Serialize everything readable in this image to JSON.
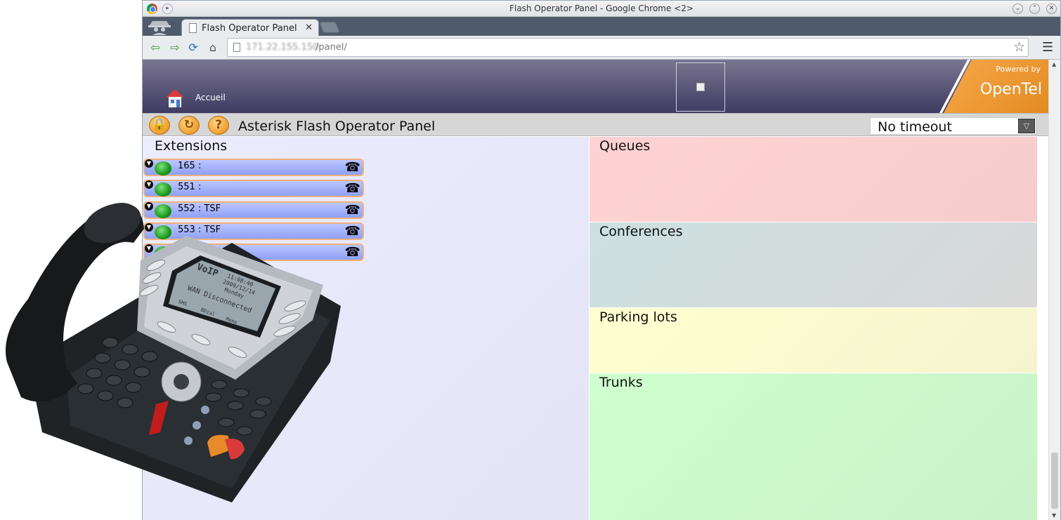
{
  "window": {
    "title": "Flash Operator Panel - Google Chrome <2>",
    "controls": [
      "⌄",
      "⌃",
      "✕"
    ]
  },
  "tab": {
    "label": "Flash Operator Panel",
    "close": "✕"
  },
  "address_bar": {
    "host": "171.22.155.150",
    "path": "/panel/"
  },
  "banner": {
    "home_label": "Accueil",
    "powered_by": "Powered by",
    "brand": "OpenTel"
  },
  "fop_toolbar": {
    "buttons": [
      "🔒",
      "↻",
      "?"
    ],
    "title": "Asterisk Flash Operator Panel",
    "timeout_value": "No timeout"
  },
  "extensions": {
    "heading": "Extensions",
    "items": [
      {
        "label": "165 :"
      },
      {
        "label": "551 :"
      },
      {
        "label": "552 : TSF"
      },
      {
        "label": "553 : TSF"
      },
      {
        "label": ""
      }
    ]
  },
  "sections": {
    "queues": "Queues",
    "conferences": "Conferences",
    "parking": "Parking lots",
    "trunks": "Trunks"
  },
  "phone_display": {
    "brand": "VoIP",
    "time": "11:08:40",
    "date": "2009/12/14",
    "day": "Monday",
    "status": "WAN Disconnected",
    "softkeys": [
      "SMS",
      "BDial",
      "Memo"
    ]
  },
  "colors": {
    "banner": "#3f3b62",
    "brand_orange": "#f3a53a",
    "extension_status": "#1a9a1a"
  }
}
